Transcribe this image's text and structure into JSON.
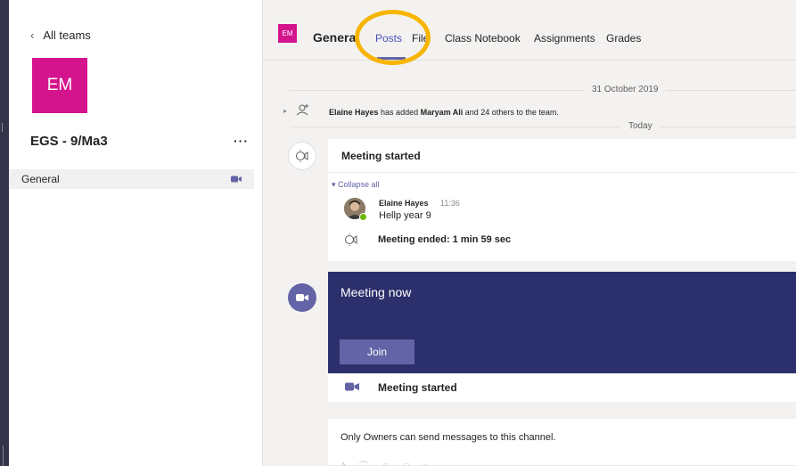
{
  "sidebar": {
    "back_label": "All teams",
    "team_initials": "EM",
    "team_name": "EGS - 9/Ma3",
    "more_label": "···",
    "channels": [
      {
        "label": "General",
        "icon": "video-camera-icon"
      }
    ]
  },
  "header": {
    "channel_initials": "EM",
    "channel_title": "Genera",
    "tabs": [
      "Posts",
      "File",
      "Class Notebook",
      "Assignments",
      "Grades"
    ],
    "active_tab": "Posts",
    "highlight_color": "#f7b500"
  },
  "feed": {
    "date_separator": "31 October 2019",
    "system_message": {
      "actor": "Elaine Hayes",
      "middle": " has added ",
      "subject": "Maryam Ali",
      "tail": " and 24 others to the team."
    },
    "today_separator": "Today",
    "meeting_card": {
      "title": "Meeting started",
      "collapse_label": "Collapse all",
      "reply": {
        "author": "Elaine Hayes",
        "time": "11:36",
        "text": "Hellp year 9"
      },
      "ended_text": "Meeting ended: 1 min 59 sec"
    },
    "meeting_now": {
      "title": "Meeting now",
      "join_label": "Join",
      "footer_text": "Meeting started",
      "bg_color": "#2b2f6b"
    }
  },
  "compose": {
    "notice": "Only Owners can send messages to this channel."
  },
  "colors": {
    "team_tile": "#d4148d",
    "accent": "#6264a7"
  }
}
